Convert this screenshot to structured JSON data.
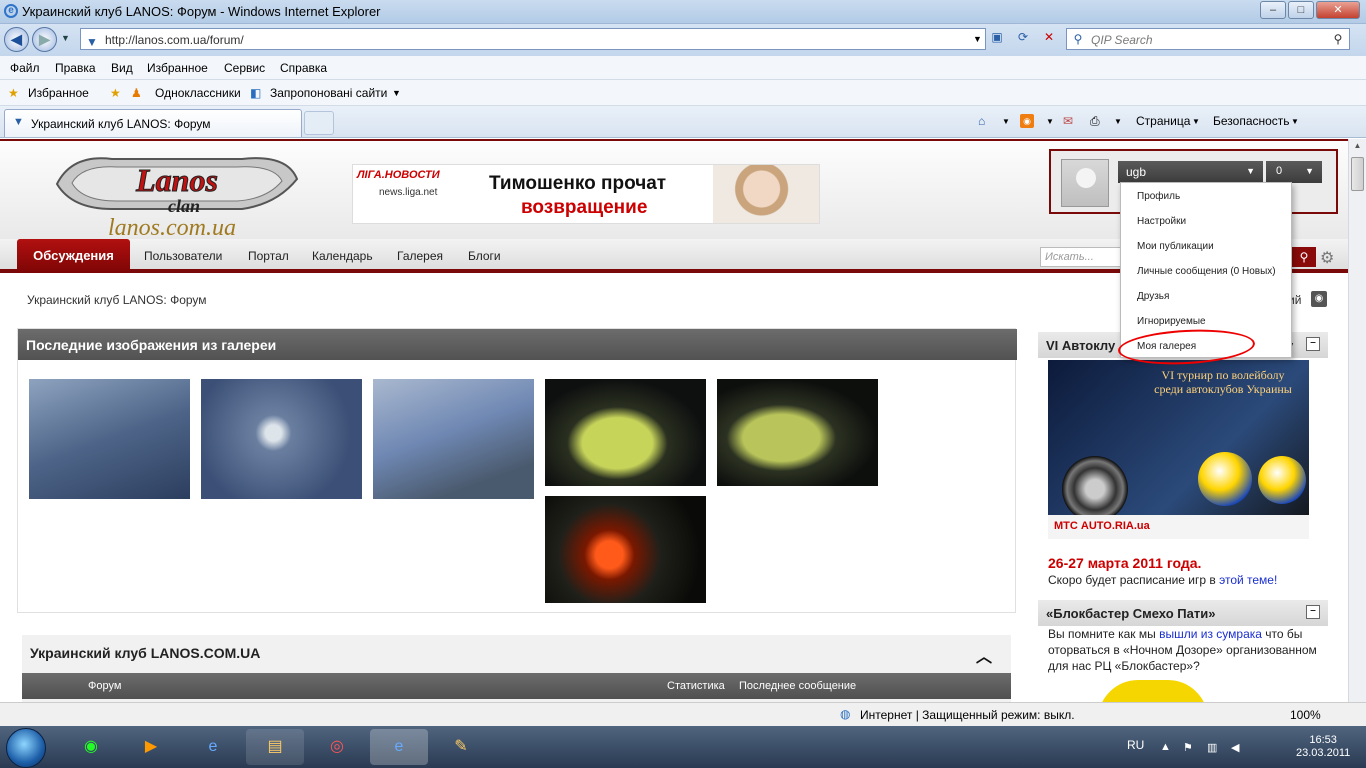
{
  "window": {
    "title": "Украинский клуб LANOS: Форум - Windows Internet Explorer",
    "minimize": "–",
    "maximize": "□",
    "close": "✕"
  },
  "browser": {
    "address": "http://lanos.com.ua/forum/",
    "search_placeholder": "QIP Search",
    "menu": [
      "Файл",
      "Правка",
      "Вид",
      "Избранное",
      "Сервис",
      "Справка"
    ],
    "favorites": {
      "label": "Избранное",
      "items": [
        "Одноклассники",
        "Запропоновані сайти"
      ]
    },
    "tab": "Украинский клуб LANOS: Форум",
    "commands": {
      "page": "Страница",
      "safety": "Безопасность"
    }
  },
  "site": {
    "logo_text": "Lanos",
    "logo_sub": "clan",
    "logo_url": "lanos.com.ua",
    "ad": {
      "brand": "ЛІГА.НОВОСТИ",
      "brand_site": "news.liga.net",
      "line1": "Тимошенко прочат",
      "line2": "возвращение"
    },
    "user": {
      "name": "ugb",
      "messages": "0"
    },
    "nav": {
      "active": "Обсуждения",
      "links": [
        "Пользователи",
        "Портал",
        "Календарь",
        "Галерея",
        "Блоги"
      ]
    },
    "search_placeholder": "Искать...",
    "breadcrumb": "Украинский клуб LANOS: Форум",
    "rss_label": "ий",
    "gallery_title": "Последние изображения из галереи",
    "forum": {
      "title": "Украинский клуб LANOS.COM.UA",
      "col_forum": "Форум",
      "col_stats": "Статистика",
      "col_last": "Последнее сообщение"
    },
    "sidebar1": {
      "title": "VI Автоклу",
      "title_end": "у",
      "banner_text": "VI турнир по волейболу среди автоклубов Украины",
      "banner_strip": "МТС   AUTO.RIA.ua",
      "date": "26-27 марта 2011 года.",
      "sched_text": "Скоро будет расписание игр в ",
      "sched_link": "этой теме!"
    },
    "sidebar2": {
      "title": "«Блокбастер Смехо Пати»",
      "text_a": "Вы помните как мы ",
      "link": "вышли из сумрака",
      "text_b": " что бы оторваться в «Ночном Дозоре» организованном для нас РЦ «Блокбастер»?"
    },
    "dropdown": [
      "Профиль",
      "Настройки",
      "Мои публикации",
      "Личные сообщения (0 Новых)",
      "Друзья",
      "Игнорируемые",
      "Моя галерея"
    ]
  },
  "statusbar": {
    "text": "Интернет | Защищенный режим: выкл.",
    "zoom": "100%"
  },
  "taskbar": {
    "lang": "RU",
    "time": "16:53",
    "date": "23.03.2011"
  }
}
